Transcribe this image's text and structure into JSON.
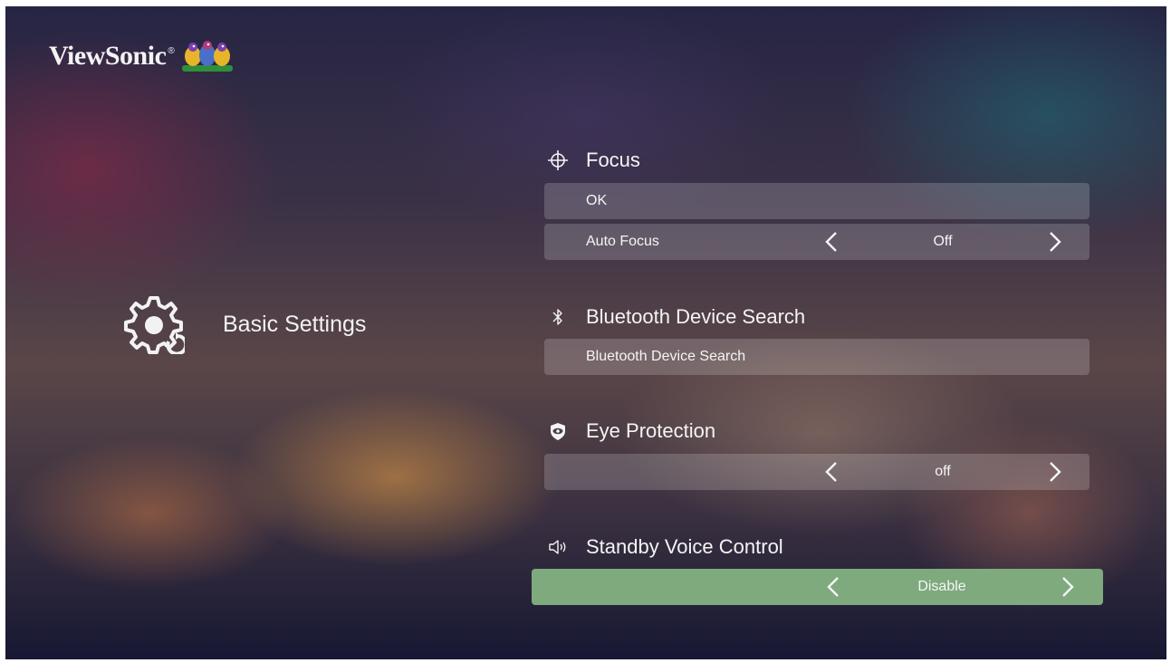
{
  "brand": {
    "name": "ViewSonic",
    "registered": "®"
  },
  "category": {
    "title": "Basic Settings",
    "icon": "gear-icon"
  },
  "sections": {
    "focus": {
      "title": "Focus",
      "icon": "crosshair-icon",
      "ok_label": "OK",
      "auto_focus": {
        "label": "Auto Focus",
        "value": "Off"
      }
    },
    "bluetooth": {
      "title": "Bluetooth Device Search",
      "icon": "bluetooth-icon",
      "button_label": "Bluetooth Device Search"
    },
    "eye_protection": {
      "title": "Eye Protection",
      "icon": "eye-shield-icon",
      "value": "off"
    },
    "standby_voice": {
      "title": "Standby Voice Control",
      "icon": "speaker-icon",
      "value": "Disable"
    }
  },
  "colors": {
    "highlight": "#7eaa7e",
    "row_bg": "rgba(255,255,255,0.18)",
    "text": "#f5f5f5"
  }
}
